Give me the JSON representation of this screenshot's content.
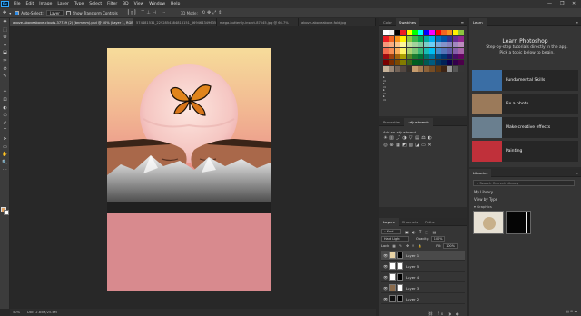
{
  "menu": {
    "items": [
      "File",
      "Edit",
      "Image",
      "Layer",
      "Type",
      "Select",
      "Filter",
      "3D",
      "View",
      "Window",
      "Help"
    ],
    "window_controls": [
      "—",
      "❐",
      "✕"
    ]
  },
  "options_bar": {
    "auto_select_label": "Auto-Select:",
    "auto_select_target": "Layer",
    "show_transform_label": "Show Transform Controls"
  },
  "doc_tabs": [
    {
      "label": "above-aboveabove-clouds-37739 (2) (bnmmm).psd @ 50% (Layer 1, RGB/8)",
      "active": true
    },
    {
      "label": "574481531_2292854384818151_3694643496357123.png",
      "active": false
    },
    {
      "label": "mega-butterfly-insect-87545.jpg @ 66.7%",
      "active": false
    },
    {
      "label": "above-aboveabove-fold.jpg",
      "active": false
    }
  ],
  "status_bar": {
    "zoom": "50%",
    "doc_info": "Doc: 2.85M/25.4M"
  },
  "tools": [
    "✥",
    "⬚",
    "ʘ",
    "⌗",
    "⬓",
    "✂",
    "⊘",
    "✎",
    "⌇",
    "✦",
    "⊡",
    "◐",
    "⬡",
    "✐",
    "T",
    "➤",
    "▭",
    "✋",
    "🔍",
    "⋯"
  ],
  "color_panels": {
    "tabs": [
      "Color",
      "Swatches"
    ],
    "active_tab": "Swatches",
    "swatch_rows": [
      [
        "#ffffff",
        "#f0f0f0",
        "#000000",
        "#ed1c24",
        "#ffff00",
        "#00ff00",
        "#00ffff",
        "#0000ff",
        "#ff00ff",
        "#ff0000",
        "#f26522",
        "#f7941d",
        "#fff200",
        "#8dc63f"
      ],
      [
        "#ed1c24",
        "#f26522",
        "#f7941d",
        "#fff200",
        "#8dc63f",
        "#39b54a",
        "#00a651",
        "#00a99d",
        "#00aeef",
        "#0072bc",
        "#0054a6",
        "#2e3192",
        "#662d91",
        "#92278f"
      ],
      [
        "#f7977a",
        "#f9ad81",
        "#fdc68a",
        "#fff79a",
        "#c4df9b",
        "#a3d39c",
        "#82ca9d",
        "#7bcdc8",
        "#6ecff6",
        "#7ea7d8",
        "#8493ca",
        "#8882be",
        "#a187be",
        "#bc8dbf"
      ],
      [
        "#f26c4f",
        "#f68e55",
        "#fbaf5c",
        "#fff467",
        "#acd372",
        "#7cc576",
        "#3bb878",
        "#1abbb4",
        "#00bff3",
        "#438ccb",
        "#5574b9",
        "#605ca8",
        "#855fa8",
        "#a763a8"
      ],
      [
        "#9e0b0f",
        "#a0410d",
        "#a36209",
        "#aba000",
        "#598527",
        "#1a7b30",
        "#007236",
        "#00746b",
        "#0076a3",
        "#004b80",
        "#003471",
        "#1b1464",
        "#440e62",
        "#630460"
      ],
      [
        "#790000",
        "#7b2e00",
        "#7d4900",
        "#827b00",
        "#406618",
        "#005e20",
        "#005826",
        "#005952",
        "#005b7f",
        "#003663",
        "#002157",
        "#0d004c",
        "#32004b",
        "#4b0049"
      ],
      [
        "#c7b299",
        "#998675",
        "#736357",
        "#534741",
        "#37302a",
        "#c69c6d",
        "#a67c52",
        "#8c6239",
        "#754c24",
        "#603913",
        "#3c2415",
        "#959595",
        "#555555",
        "#363636"
      ]
    ],
    "adjustments_tabs": [
      "Properties",
      "Adjustments"
    ],
    "adjustments_active": "Adjustments",
    "adjustments_label": "Add an adjustment",
    "adjustment_icons": [
      "brightness-icon",
      "levels-icon",
      "curves-icon",
      "exposure-icon",
      "vibrance-icon",
      "hue-sat-icon",
      "color-balance-icon",
      "bw-icon",
      "photo-filter-icon",
      "channel-mixer-icon",
      "color-lookup-icon",
      "invert-icon",
      "posterize-icon",
      "threshold-icon",
      "gradient-map-icon",
      "selective-color-icon"
    ]
  },
  "layers_panel": {
    "tabs": [
      "Layers",
      "Channels",
      "Paths"
    ],
    "active_tab": "Layers",
    "kind_label": "Kind",
    "blend_mode": "Hard Light",
    "opacity_label": "Opacity:",
    "opacity_value": "100%",
    "lock_label": "Lock:",
    "fill_label": "Fill:",
    "fill_value": "100%",
    "layers": [
      {
        "name": "Layer 1",
        "selected": true
      },
      {
        "name": "Layer 5",
        "selected": false
      },
      {
        "name": "Layer 4",
        "selected": false
      },
      {
        "name": "Layer 3",
        "selected": false
      },
      {
        "name": "Layer 2",
        "selected": false
      }
    ]
  },
  "learn_panel": {
    "tab": "Learn",
    "title": "Learn Photoshop",
    "description": "Step-by-step tutorials directly in the app. Pick a topic below to begin.",
    "cards": [
      {
        "label": "Fundamental Skills",
        "color": "#3a6ea5"
      },
      {
        "label": "Fix a photo",
        "color": "#9b7a5a"
      },
      {
        "label": "Make creative effects",
        "color": "#6a7f8f"
      },
      {
        "label": "Painting",
        "color": "#c0303a"
      }
    ]
  },
  "libraries_panel": {
    "tab": "Libraries",
    "search_placeholder": "Search Current Library",
    "library_name": "My Library",
    "view_by_label": "View by Type",
    "section_label": "Graphics"
  },
  "colors": {
    "canvas_bg": "#282828",
    "artboard_pink": "#d88a8e",
    "sunset_top": "#f7d79a",
    "sunset_bottom": "#e98a8c"
  }
}
